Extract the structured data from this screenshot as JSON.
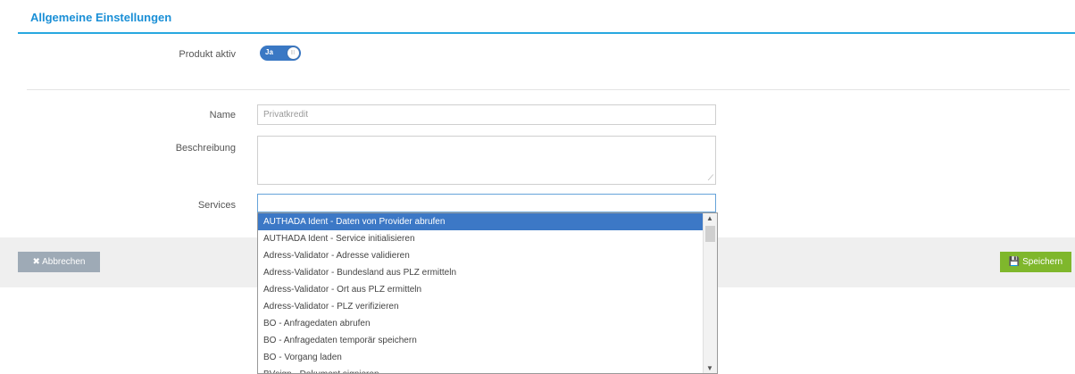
{
  "section": {
    "title": "Allgemeine Einstellungen"
  },
  "fields": {
    "produkt_aktiv_label": "Produkt aktiv",
    "toggle_on_label": "Ja",
    "name_label": "Name",
    "name_value": "Privatkredit",
    "beschreibung_label": "Beschreibung",
    "beschreibung_value": "",
    "services_label": "Services",
    "services_value": ""
  },
  "dropdown": {
    "items": [
      "AUTHADA Ident - Daten von Provider abrufen",
      "AUTHADA Ident - Service initialisieren",
      "Adress-Validator - Adresse validieren",
      "Adress-Validator - Bundesland aus PLZ ermitteln",
      "Adress-Validator - Ort aus PLZ ermitteln",
      "Adress-Validator - PLZ verifizieren",
      "BO - Anfragedaten abrufen",
      "BO - Anfragedaten temporär speichern",
      "BO - Vorgang laden",
      "BVsign - Dokument signieren"
    ],
    "selected_index": 0
  },
  "buttons": {
    "cancel_label": "✖ Abbrechen",
    "save_label": "💾 Speichern"
  },
  "colors": {
    "accent": "#1a8fd6",
    "save": "#7fb72c",
    "cancel": "#9eaab6",
    "selected": "#3c78c6"
  },
  "icons": {
    "cancel": "close-icon",
    "save": "floppy-disk-icon",
    "resize": "resize-handle-icon"
  }
}
